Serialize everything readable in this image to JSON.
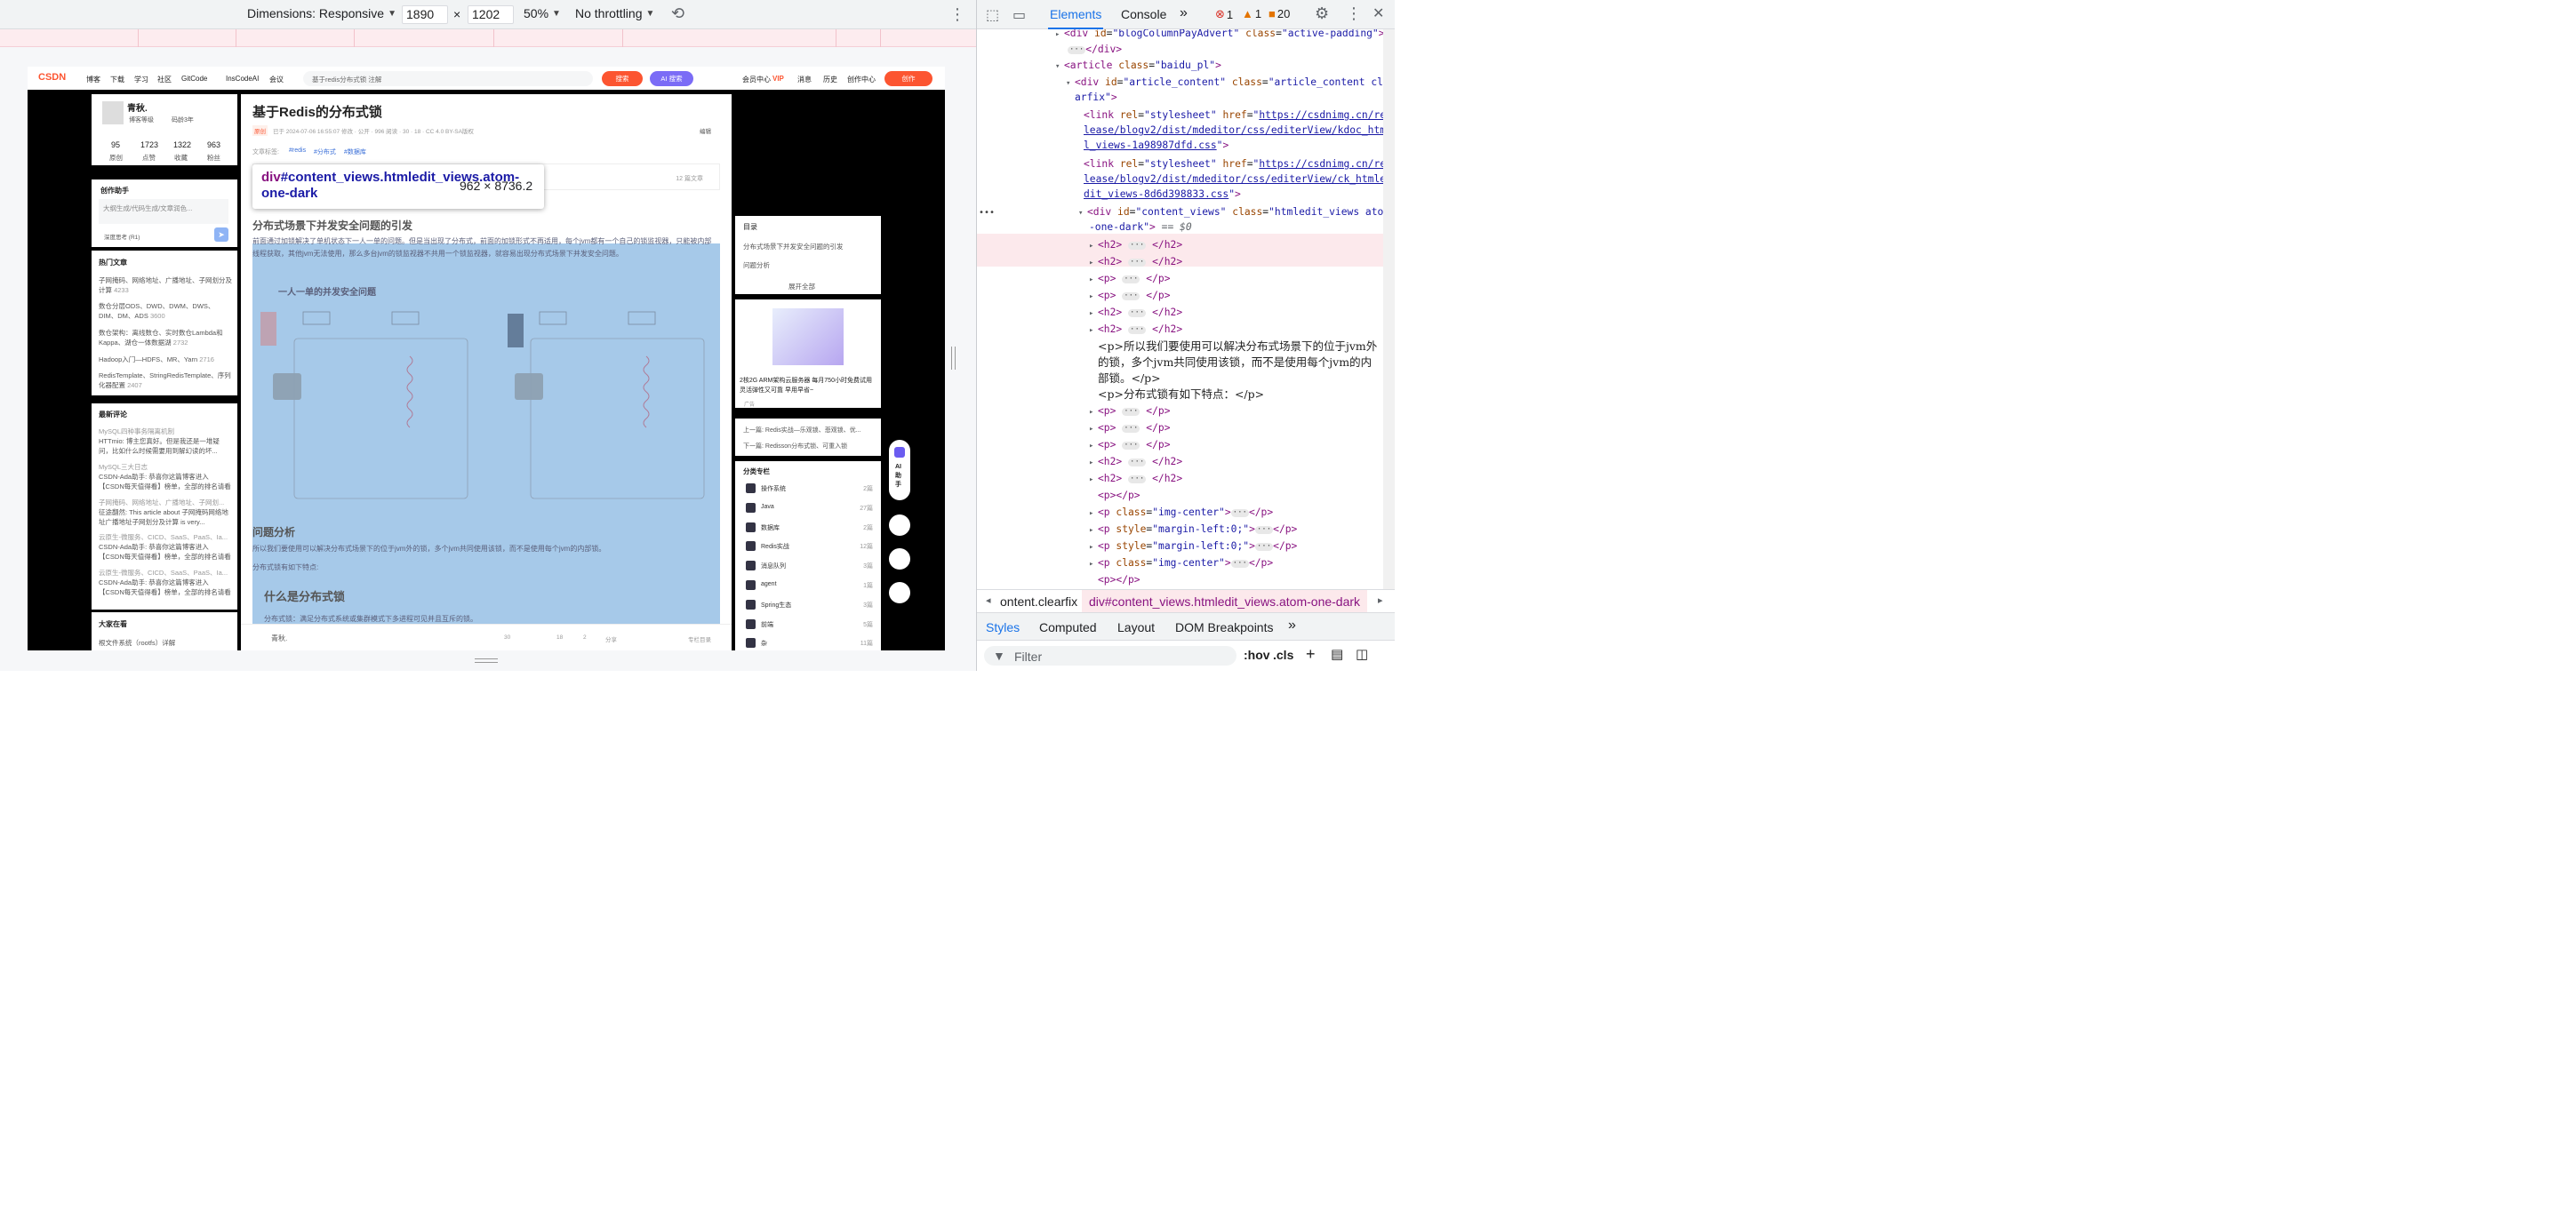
{
  "device_toolbar": {
    "dimensions_label": "Dimensions: Responsive",
    "width": "1890",
    "times": "×",
    "height": "1202",
    "zoom": "50%",
    "throttling": "No throttling"
  },
  "csdn": {
    "logo": "CSDN",
    "nav": [
      "博客",
      "下载",
      "学习",
      "社区",
      "GitCode",
      "InsCodeAI",
      "会议"
    ],
    "search_placeholder": "基于redis分布式锁 注解",
    "search_btn": "搜索",
    "ai_btn": "AI 搜索",
    "right_nav": [
      "会员中心",
      "消息",
      "历史",
      "创作中心"
    ],
    "vip_badge": "VIP",
    "create_btn": "创作"
  },
  "author": {
    "name": "青秋.",
    "level": "博客等级",
    "age": "码龄3年",
    "stats": [
      {
        "value": "95",
        "label": "原创"
      },
      {
        "value": "1723",
        "label": "点赞"
      },
      {
        "value": "1322",
        "label": "收藏"
      },
      {
        "value": "963",
        "label": "粉丝"
      }
    ]
  },
  "assistant": {
    "title": "创作助手",
    "placeholder": "大纲生成/代码生成/文章润色...",
    "deep": "深度思考 (R1)"
  },
  "hot": {
    "title": "热门文章",
    "items": [
      {
        "text": "子网掩码、网络地址、广播地址、子网划分及计算",
        "count": "4233"
      },
      {
        "text": "数仓分层ODS、DWD、DWM、DWS、DIM、DM、ADS",
        "count": "3600"
      },
      {
        "text": "数仓架构：离线数仓、实时数仓Lambda和Kappa、湖仓一体数据湖",
        "count": "2732"
      },
      {
        "text": "Hadoop入门—HDFS、MR、Yarn",
        "count": "2716"
      },
      {
        "text": "RedisTemplate、StringRedisTemplate、序列化器配置",
        "count": "2407"
      }
    ]
  },
  "comments": {
    "title": "最新评论",
    "items": [
      {
        "src": "MySQL四种事务隔离机制",
        "text": "HTTmio: 博主您真好。但是我还是一堆疑问，比如什么时候需要用到解幻读的坏..."
      },
      {
        "src": "MySQL三大日志",
        "text": "CSDN-Ada助手: 恭喜你这篇博客进入【CSDN每天值得看】榜单，全部的排名请看 ht..."
      },
      {
        "src": "子网掩码、网络地址、广播地址、子网划...",
        "text": "征途翻然: This article about 子网掩码网络地址广播地址子网划分及计算 is very..."
      },
      {
        "src": "云原生-微服务、CICD、SaaS、PaaS、Ia...",
        "text": "CSDN-Ada助手: 恭喜你这篇博客进入【CSDN每天值得看】榜单，全部的排名请看 ht..."
      },
      {
        "src": "云原生-微服务、CICD、SaaS、PaaS、Ia...",
        "text": "CSDN-Ada助手: 恭喜你这篇博客进入【CSDN每天值得看】榜单，全部的排名请看 ht..."
      }
    ]
  },
  "recommend": {
    "title": "大家在看",
    "item": "根文件系统（rootfs）详解"
  },
  "article": {
    "title": "基于Redis的分布式锁",
    "tag_original": "原创",
    "meta": "已于 2024-07-06 16:55:07 修改 · 公开 · 996 阅读 · 30 · 18 · CC 4.0 BY-SA版权",
    "edit": "编辑",
    "tags_label": "文章标签:",
    "tags": [
      "#redis",
      "#分布式",
      "#数据库"
    ],
    "column_count": "12 篇文章",
    "h2_1": "分布式场景下并发安全问题的引发",
    "p1": "前面通过加锁解决了单机状态下一人一单的问题。但是当出现了分布式，前面的加锁形式不再适用，每个jvm都有一个自己的锁监视器，只能被内部线程获取，其他jvm无法使用，那么多台jvm的锁监视器不共用一个锁监视器，就容易出现分布式场景下并发安全问题。",
    "h3_1": "一人一单的并发安全问题",
    "h2_2": "问题分析",
    "p2": "所以我们要使用可以解决分布式场景下的位于jvm外的锁，多个jvm共同使用该锁，而不是使用每个jvm的内部锁。",
    "p3": "分布式锁有如下特点:",
    "h2_3": "什么是分布式锁",
    "p4": "分布式锁：满足分布式系统或集群模式下多进程可见并且互斥的锁。",
    "author_footer": "青秋.",
    "footer_actions": [
      "30",
      "18",
      "2",
      "分享",
      "专栏目录"
    ]
  },
  "tooltip": {
    "selector_tag": "div",
    "selector_rest": "#content_views.htmledit_views.atom-one-dark",
    "dims": "962 × 8736.2"
  },
  "toc": {
    "title": "目录",
    "items": [
      "分布式场景下并发安全问题的引发",
      "问题分析"
    ],
    "expand": "展开全部"
  },
  "ad": {
    "text": "2核2G ARM架构云服务器 每月750小时免费试用 灵活弹性又可靠 早用早省~",
    "label": "广告"
  },
  "prevnext": {
    "prev": "上一篇:  Redis实战—乐观锁、悲观锁、优...",
    "next": "下一篇:  Redisson分布式锁、可重入锁"
  },
  "categories": {
    "title": "分类专栏",
    "items": [
      {
        "name": "操作系统",
        "count": "2篇"
      },
      {
        "name": "Java",
        "count": "27篇"
      },
      {
        "name": "数据库",
        "count": "2篇"
      },
      {
        "name": "Redis实战",
        "count": "12篇"
      },
      {
        "name": "消息队列",
        "count": "3篇"
      },
      {
        "name": "agent",
        "count": "1篇"
      },
      {
        "name": "Spring生态",
        "count": "3篇"
      },
      {
        "name": "前端",
        "count": "5篇"
      },
      {
        "name": "杂",
        "count": "11篇"
      }
    ]
  },
  "ai_helper": "AI 助手",
  "devtools": {
    "tabs": [
      "Elements",
      "Console"
    ],
    "errors": "1",
    "warnings": "1",
    "issues": "20",
    "lines": [
      "<div id=\"blogColumnPayAdvert\" class=\"active-padding\">",
      "</div>",
      "<article class=\"baidu_pl\">",
      "<div id=\"article_content\" class=\"article_content clearfix\">",
      "<link rel=\"stylesheet\" href=\"https://csdnimg.cn/release/blogv2/dist/mdeditor/css/editerView/kdoc_html_views-1a98987dfd.css\">",
      "<link rel=\"stylesheet\" href=\"https://csdnimg.cn/release/blogv2/dist/mdeditor/css/editerView/ck_htmledit_views-8d6d398833.css\">",
      "<div id=\"content_views\" class=\"htmledit_views atom-one-dark\"> == $0"
    ],
    "text_p1": "<p>所以我们要使用可以解决分布式场景下的位于jvm外的锁，多个jvm共同使用该锁，而不是使用每个jvm的内部锁。</p>",
    "text_p2": "<p>分布式锁有如下特点：</p>",
    "breadcrumb_1": "ontent.clearfix",
    "breadcrumb_2": "div#content_views.htmledit_views.atom-one-dark",
    "subtabs": [
      "Styles",
      "Computed",
      "Layout",
      "DOM Breakpoints"
    ],
    "filter_placeholder": "Filter",
    "hov": ":hov",
    "cls": ".cls"
  }
}
